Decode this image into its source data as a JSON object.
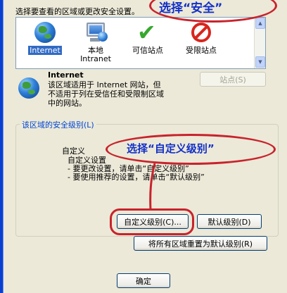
{
  "intro_text": "选择要查看的区域或更改安全设置。",
  "zones": [
    {
      "label": "Internet",
      "label2": "",
      "icon": "globe-icon",
      "selected": true
    },
    {
      "label": "本地",
      "label2": "Intranet",
      "icon": "computer-icon",
      "selected": false
    },
    {
      "label": "可信站点",
      "label2": "",
      "icon": "check-icon",
      "selected": false
    },
    {
      "label": "受限站点",
      "label2": "",
      "icon": "restricted-icon",
      "selected": false
    }
  ],
  "description": {
    "title": "Internet",
    "lines": [
      "该区域适用于 Internet 网站，但",
      "不适用于列在受信任和受限制区域",
      "中的网站。"
    ]
  },
  "sites_button": "站点(S)",
  "security": {
    "group_title": "该区域的安全级别(L)",
    "level_name": "自定义",
    "lines": [
      "自定义设置",
      "- 要更改设置，请单击“自定义级别”",
      "- 要使用推荐的设置，请单击“默认级别”"
    ]
  },
  "buttons": {
    "custom_level": "自定义级别(C)...",
    "default_level": "默认级别(D)",
    "reset_all": "将所有区域重置为默认级别(R)",
    "ok": "确定"
  },
  "annotations": {
    "top": "选择“安全”",
    "middle": "选择“自定义级别”"
  },
  "colors": {
    "annotation_red": "#c8232c",
    "annotation_blue": "#1330c8",
    "selection": "#316ac5",
    "group_title": "#0046d5"
  }
}
